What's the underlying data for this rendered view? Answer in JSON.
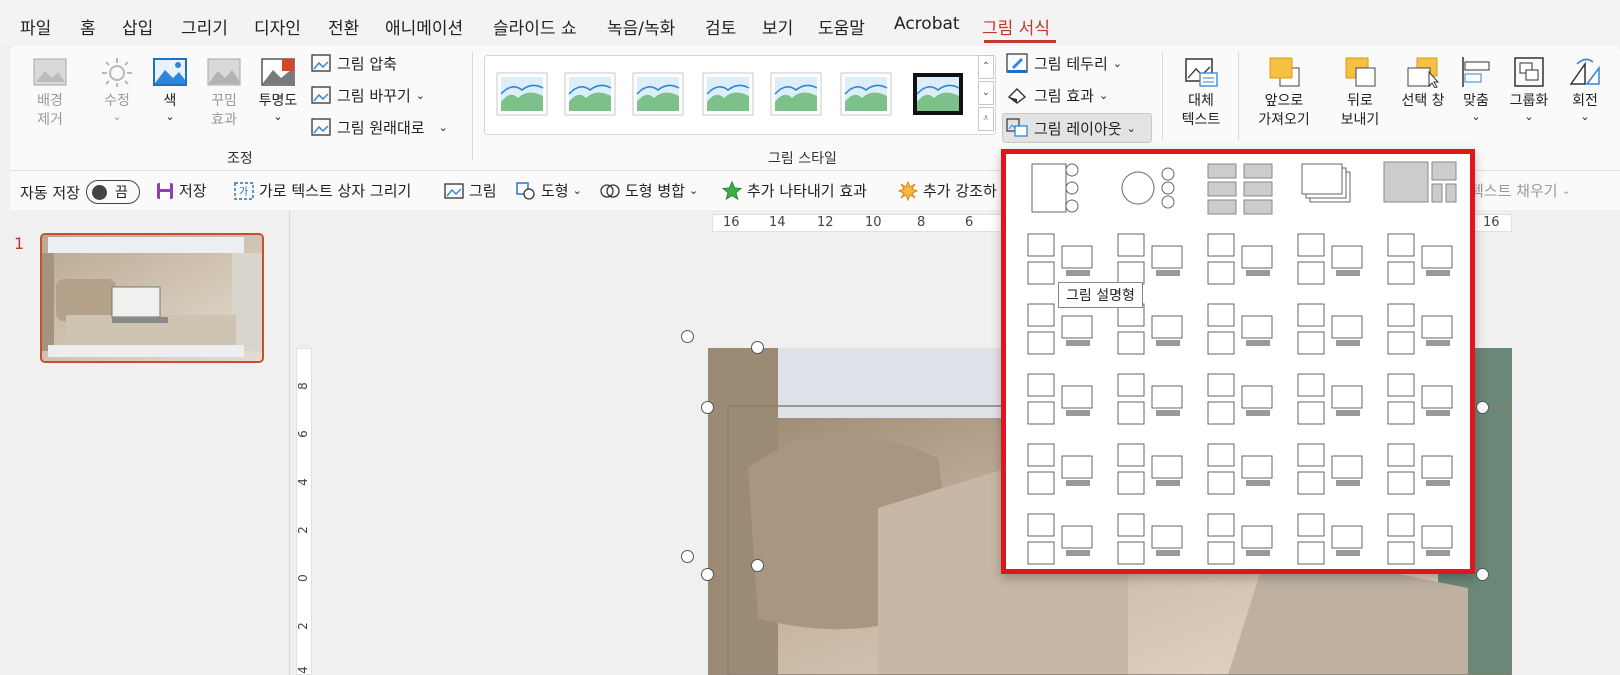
{
  "menu": [
    {
      "label": "파일"
    },
    {
      "label": "홈"
    },
    {
      "label": "삽입"
    },
    {
      "label": "그리기"
    },
    {
      "label": "디자인"
    },
    {
      "label": "전환"
    },
    {
      "label": "애니메이션"
    },
    {
      "label": "슬라이드 쇼"
    },
    {
      "label": "녹음/녹화"
    },
    {
      "label": "검토"
    },
    {
      "label": "보기"
    },
    {
      "label": "도움말"
    },
    {
      "label": "Acrobat"
    },
    {
      "label": "그림 서식"
    }
  ],
  "ribbon": {
    "adjust": {
      "remove_bg": "배경\n제거",
      "corrections": "수정",
      "color": "색",
      "artistic": "꾸밈\n효과",
      "transparency": "투명도",
      "compress": "그림 압축",
      "change": "그림 바꾸기",
      "reset": "그림 원래대로",
      "group_label": "조정"
    },
    "styles": {
      "group_label": "그림 스타일",
      "border": "그림 테두리",
      "effects": "그림 효과",
      "layout": "그림 레이아웃"
    },
    "alt_text": {
      "line1": "대체",
      "line2": "텍스트"
    },
    "arrange": {
      "bring_forward_1": "앞으로",
      "bring_forward_2": "가져오기",
      "send_backward_1": "뒤로",
      "send_backward_2": "보내기",
      "selection_pane": "선택 창",
      "align": "맞춤",
      "group": "그룹화",
      "rotate": "회전"
    }
  },
  "qat": {
    "autosave": "자동 저장",
    "autosave_state": "끔",
    "save": "저장",
    "textbox": "가로 텍스트 상자 그리기",
    "picture": "그림",
    "shapes": "도형",
    "merge": "도형 병합",
    "add_effect": "추가 나타내기 효과",
    "add_emphasis": "추가 강조하",
    "text_fill": "텍스트 채우기"
  },
  "slides": {
    "number": "1"
  },
  "ruler": {
    "h_left": [
      "16",
      "14",
      "12",
      "10",
      "8",
      "6"
    ],
    "h_right": "16",
    "v_labels": [
      "8",
      "6",
      "4",
      "2",
      "0",
      "2",
      "4"
    ]
  },
  "tooltip": "그림 설명형",
  "colors": {
    "accent": "#c0392b",
    "panel_border": "#e0161e"
  }
}
